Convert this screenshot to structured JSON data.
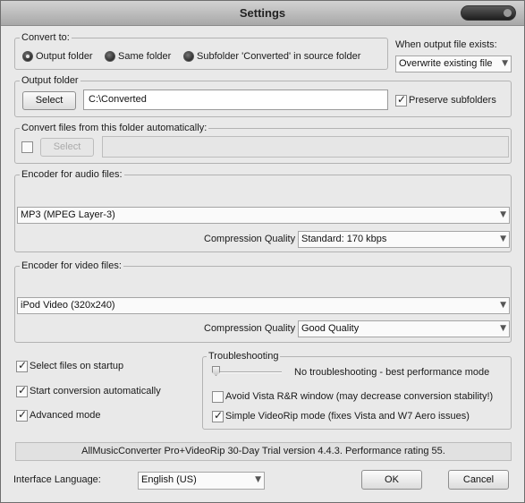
{
  "window": {
    "title": "Settings"
  },
  "convert_to": {
    "legend": "Convert to:",
    "options": [
      "Output folder",
      "Same folder",
      "Subfolder 'Converted' in source folder"
    ],
    "selected": "Output folder"
  },
  "output_exists": {
    "label": "When output file exists:",
    "value": "Overwrite existing file"
  },
  "output_folder": {
    "legend": "Output folder",
    "select_label": "Select",
    "path": "C:\\Converted",
    "preserve_label": "Preserve subfolders",
    "preserve_checked": true
  },
  "auto_convert": {
    "legend": "Convert files from this folder automatically:",
    "enabled": false,
    "select_label": "Select",
    "path": ""
  },
  "audio": {
    "legend": "Encoder for audio files:",
    "encoder": "MP3 (MPEG Layer-3)",
    "quality_label": "Compression Quality",
    "quality": "Standard: 170 kbps"
  },
  "video": {
    "legend": "Encoder for video files:",
    "encoder": "iPod Video (320x240)",
    "quality_label": "Compression Quality",
    "quality": "Good Quality"
  },
  "options": {
    "select_on_startup": {
      "label": "Select files on startup",
      "checked": true
    },
    "start_auto": {
      "label": "Start conversion automatically",
      "checked": true
    },
    "advanced": {
      "label": "Advanced mode",
      "checked": true
    }
  },
  "troubleshooting": {
    "legend": "Troubleshooting",
    "slider_label": "No troubleshooting - best performance mode",
    "slider_level": 0,
    "avoid_vista": {
      "label": "Avoid Vista R&R window (may decrease conversion stability!)",
      "checked": false
    },
    "simple_videorip": {
      "label": "Simple VideoRip mode (fixes Vista and W7 Aero issues)",
      "checked": true
    }
  },
  "status": "AllMusicConverter Pro+VideoRip 30-Day Trial version 4.4.3. Performance rating 55.",
  "footer": {
    "language_label": "Interface Language:",
    "language_value": "English (US)",
    "ok_label": "OK",
    "cancel_label": "Cancel"
  }
}
